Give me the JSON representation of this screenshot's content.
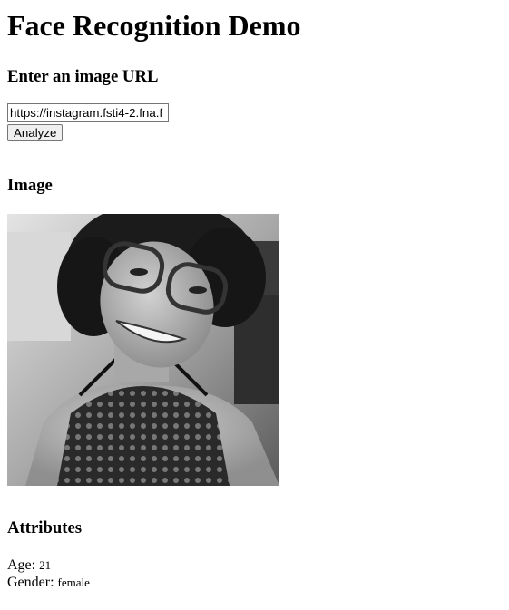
{
  "title": "Face Recognition Demo",
  "url_section": {
    "heading": "Enter an image URL",
    "input_value": "https://instagram.fsti4-2.fna.f",
    "button_label": "Analyze"
  },
  "image_section": {
    "heading": "Image"
  },
  "attributes_section": {
    "heading": "Attributes",
    "age_label": "Age:",
    "age_value": "21",
    "gender_label": "Gender:",
    "gender_value": "female"
  }
}
